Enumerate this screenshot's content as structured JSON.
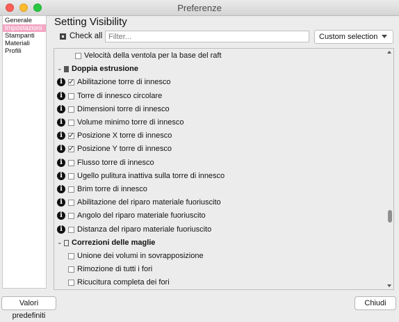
{
  "window": {
    "title": "Preferenze"
  },
  "sidebar": {
    "items": [
      "Generale",
      "Impostazioni",
      "Stampanti",
      "Materiali",
      "Profili"
    ],
    "active_index": 1
  },
  "heading": "Setting Visibility",
  "check_all": {
    "label": "Check all"
  },
  "filter": {
    "placeholder": "Filter..."
  },
  "selection": {
    "value": "Custom selection"
  },
  "list": {
    "rows": [
      {
        "type": "setting",
        "label": "Velocità della ventola per la base del raft",
        "checked": false,
        "info": false,
        "indent": "deep"
      },
      {
        "type": "category",
        "label": "Doppia estrusione",
        "icon": "extruder-icon"
      },
      {
        "type": "setting",
        "label": "Abilitazione torre di innesco",
        "checked": true,
        "info": true
      },
      {
        "type": "setting",
        "label": "Torre di innesco circolare",
        "checked": false,
        "info": true
      },
      {
        "type": "setting",
        "label": "Dimensioni torre di innesco",
        "checked": false,
        "info": true
      },
      {
        "type": "setting",
        "label": "Volume minimo torre di innesco",
        "checked": false,
        "info": true
      },
      {
        "type": "setting",
        "label": "Posizione X torre di innesco",
        "checked": true,
        "info": true
      },
      {
        "type": "setting",
        "label": "Posizione Y torre di innesco",
        "checked": true,
        "info": true
      },
      {
        "type": "setting",
        "label": "Flusso torre di innesco",
        "checked": false,
        "info": true
      },
      {
        "type": "setting",
        "label": "Ugello pulitura inattiva sulla torre di innesco",
        "checked": false,
        "info": true
      },
      {
        "type": "setting",
        "label": "Brim torre di innesco",
        "checked": false,
        "info": true
      },
      {
        "type": "setting",
        "label": "Abilitazione del riparo materiale fuoriuscito",
        "checked": false,
        "info": true
      },
      {
        "type": "setting",
        "label": "Angolo del riparo materiale fuoriuscito",
        "checked": false,
        "info": true
      },
      {
        "type": "setting",
        "label": "Distanza del riparo materiale fuoriuscito",
        "checked": false,
        "info": true
      },
      {
        "type": "category",
        "label": "Correzioni delle maglie",
        "icon": "mesh-fixes-icon"
      },
      {
        "type": "setting",
        "label": "Unione dei volumi in sovrapposizione",
        "checked": false,
        "info": false
      },
      {
        "type": "setting",
        "label": "Rimozione di tutti i fori",
        "checked": false,
        "info": false
      },
      {
        "type": "setting",
        "label": "Ricucitura completa dei fori",
        "checked": false,
        "info": false
      }
    ]
  },
  "buttons": {
    "defaults": "Valori predefiniti",
    "close": "Chiudi"
  }
}
